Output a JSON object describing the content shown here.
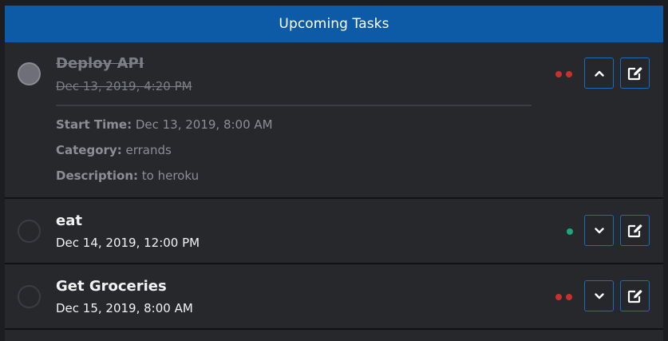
{
  "header": {
    "title": "Upcoming Tasks"
  },
  "tasks": [
    {
      "title": "Deploy API",
      "date": "Dec 13, 2019, 4:20 PM",
      "completed": true,
      "expanded": true,
      "priority_dots": 2,
      "priority_color": "#c9302c",
      "details": {
        "start_label": "Start Time:",
        "start_value": " Dec 13, 2019, 8:00 AM",
        "category_label": "Category:",
        "category_value": " errands",
        "description_label": "Description:",
        "description_value": " to heroku"
      },
      "toggle_icon": "chevron-up-icon",
      "edit_icon": "edit-icon"
    },
    {
      "title": "eat",
      "date": "Dec 14, 2019, 12:00 PM",
      "completed": false,
      "expanded": false,
      "priority_dots": 1,
      "priority_color": "#1fa67a",
      "toggle_icon": "chevron-down-icon",
      "edit_icon": "edit-icon"
    },
    {
      "title": "Get Groceries",
      "date": "Dec 15, 2019, 8:00 AM",
      "completed": false,
      "expanded": false,
      "priority_dots": 2,
      "priority_color": "#c9302c",
      "toggle_icon": "chevron-down-icon",
      "edit_icon": "edit-icon"
    }
  ],
  "colors": {
    "header_bg": "#0d5aa7",
    "panel_bg": "#27282c",
    "button_border": "#1b6cc0"
  }
}
